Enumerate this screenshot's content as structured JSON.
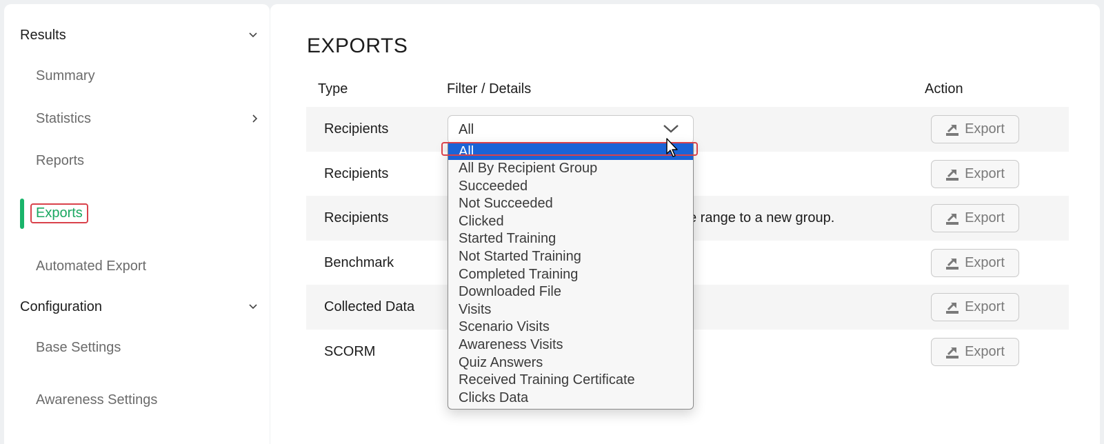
{
  "sidebar": {
    "sections": [
      {
        "label": "Results"
      },
      {
        "label": "Configuration"
      }
    ],
    "items": [
      {
        "label": "Summary"
      },
      {
        "label": "Statistics"
      },
      {
        "label": "Reports"
      },
      {
        "label": "Exports"
      },
      {
        "label": "Automated Export"
      },
      {
        "label": "Base Settings"
      },
      {
        "label": "Awareness Settings"
      }
    ]
  },
  "main": {
    "title": "EXPORTS",
    "columns": {
      "type": "Type",
      "filter": "Filter / Details",
      "action": "Action"
    },
    "rows": [
      {
        "type": "Recipients",
        "detail": ""
      },
      {
        "type": "Recipients",
        "detail": ""
      },
      {
        "type": "Recipients",
        "detail": "e range to a new group."
      },
      {
        "type": "Benchmark",
        "detail": ""
      },
      {
        "type": "Collected Data",
        "detail": ""
      },
      {
        "type": "SCORM",
        "detail": ""
      }
    ],
    "export_label": "Export",
    "select": {
      "value": "All",
      "options": [
        "All",
        "All By Recipient Group",
        "Succeeded",
        "Not Succeeded",
        "Clicked",
        "Started Training",
        "Not Started Training",
        "Completed Training",
        "Downloaded File",
        "Visits",
        "Scenario Visits",
        "Awareness Visits",
        "Quiz Answers",
        "Received Training Certificate",
        "Clicks Data"
      ]
    }
  },
  "colors": {
    "accent_green": "#19b46a",
    "selection_blue": "#1a63d6",
    "highlight_red": "#d9414a"
  }
}
